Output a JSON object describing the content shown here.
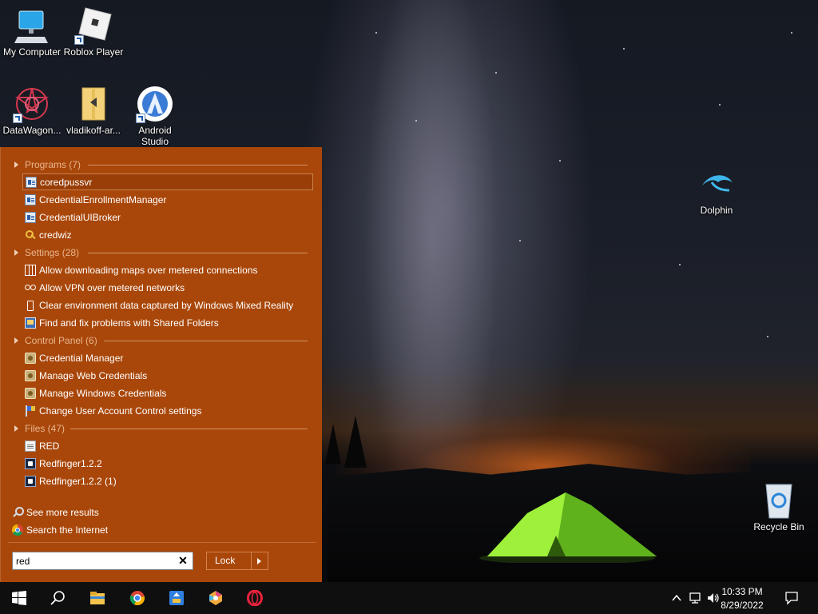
{
  "desktop": {
    "icons": [
      {
        "label": "My Computer"
      },
      {
        "label": "Roblox Player"
      },
      {
        "label": "DataWagon..."
      },
      {
        "label": "vladikoff-ar..."
      },
      {
        "label": "Android\nStudio"
      },
      {
        "label": "Dolphin"
      },
      {
        "label": "Recycle Bin"
      }
    ]
  },
  "start_panel": {
    "groups": [
      {
        "header": "Programs (7)",
        "items": [
          {
            "label": "coredpussvr",
            "icon": "app-icon",
            "selected": true
          },
          {
            "label": "CredentialEnrollmentManager",
            "icon": "app-icon"
          },
          {
            "label": "CredentialUIBroker",
            "icon": "app-icon"
          },
          {
            "label": "credwiz",
            "icon": "key-icon"
          }
        ]
      },
      {
        "header": "Settings (28)",
        "items": [
          {
            "label": "Allow downloading maps over metered connections",
            "icon": "map-icon"
          },
          {
            "label": "Allow VPN over metered networks",
            "icon": "vpn-icon"
          },
          {
            "label": "Clear environment data captured by Windows Mixed Reality",
            "icon": "mixed-reality-icon"
          },
          {
            "label": "Find and fix problems with Shared Folders",
            "icon": "shared-folders-icon"
          }
        ]
      },
      {
        "header": "Control Panel (6)",
        "items": [
          {
            "label": "Credential Manager",
            "icon": "control-panel-icon"
          },
          {
            "label": "Manage Web Credentials",
            "icon": "control-panel-icon"
          },
          {
            "label": "Manage Windows Credentials",
            "icon": "control-panel-icon"
          },
          {
            "label": "Change User Account Control settings",
            "icon": "uac-flag-icon"
          }
        ]
      },
      {
        "header": "Files (47)",
        "items": [
          {
            "label": "RED",
            "icon": "file-icon"
          },
          {
            "label": "Redfinger1.2.2",
            "icon": "redfinger-icon"
          },
          {
            "label": "Redfinger1.2.2 (1)",
            "icon": "redfinger-icon"
          }
        ]
      }
    ],
    "see_more": "See more results",
    "search_internet": "Search the Internet",
    "search": {
      "value": "red"
    },
    "lock_label": "Lock"
  },
  "taskbar": {
    "pinned": [
      "start-button",
      "search-button",
      "file-explorer",
      "chrome",
      "app-installer",
      "app-hexagon",
      "opera"
    ],
    "clock_time": "10:33 PM",
    "clock_date": "8/29/2022"
  },
  "colors": {
    "panel": "#a9470a",
    "group_header": "#e8b58d",
    "taskbar": "#0f0f10"
  }
}
